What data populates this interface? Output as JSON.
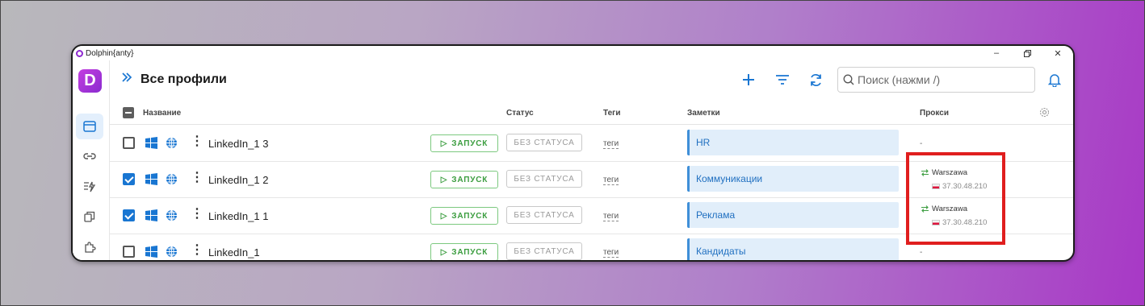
{
  "window": {
    "title": "Dolphin{anty}"
  },
  "sidebar": {
    "logo_letter": "D"
  },
  "header": {
    "title": "Все профили",
    "search_placeholder": "Поиск (нажми /)"
  },
  "columns": {
    "name": "Название",
    "status": "Статус",
    "tags": "Теги",
    "notes": "Заметки",
    "proxy": "Прокси"
  },
  "rows": [
    {
      "name": "LinkedIn_1 3",
      "checked": false,
      "run": "ЗАПУСК",
      "status": "БЕЗ СТАТУСА",
      "tags": "теги",
      "note": "HR",
      "proxy_empty": "-"
    },
    {
      "name": "LinkedIn_1 2",
      "checked": true,
      "run": "ЗАПУСК",
      "status": "БЕЗ СТАТУСА",
      "tags": "теги",
      "note": "Коммуникации",
      "proxy_city": "Warszawa",
      "proxy_ip": "37.30.48.210"
    },
    {
      "name": "LinkedIn_1 1",
      "checked": true,
      "run": "ЗАПУСК",
      "status": "БЕЗ СТАТУСА",
      "tags": "теги",
      "note": "Реклама",
      "proxy_city": "Warszawa",
      "proxy_ip": "37.30.48.210"
    },
    {
      "name": "LinkedIn_1",
      "checked": false,
      "run": "ЗАПУСК",
      "status": "БЕЗ СТАТУСА",
      "tags": "теги",
      "note": "Кандидаты",
      "proxy_empty": "-"
    }
  ],
  "colors": {
    "accent": "#1976d2",
    "brand": "#9b30d9",
    "run_green": "#3b9d3f",
    "highlight": "#e01e1e"
  }
}
